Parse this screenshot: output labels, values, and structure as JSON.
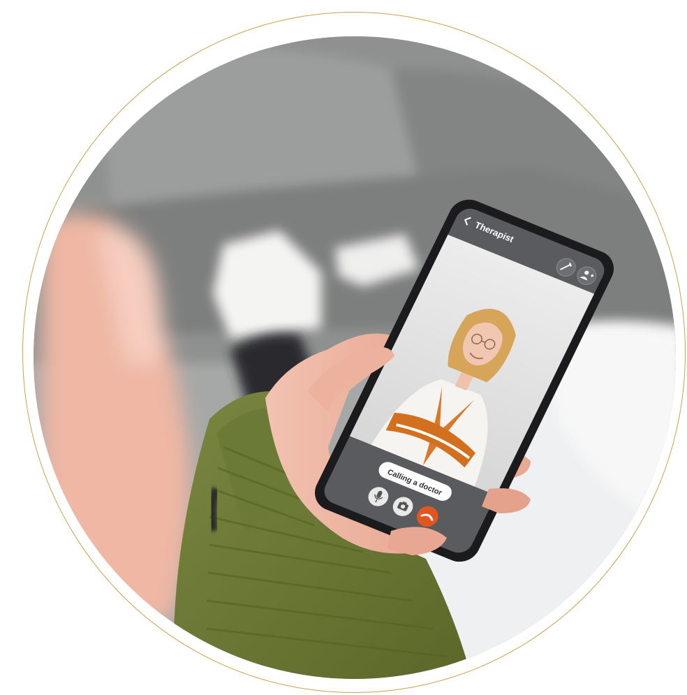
{
  "colors": {
    "ring": "#c9a24a",
    "sofa": "#8d8f8e",
    "sweater": "#6e7a33",
    "phone_frame": "#1b1b1d",
    "app_background": "#595b5e",
    "end_call": "#e2561f"
  },
  "phone": {
    "back_icon": "chevron-left-icon",
    "title": "Therapist",
    "edit_icon": "pencil-icon",
    "add_contact_icon": "person-add-icon",
    "status": "Calling a doctor",
    "mic_icon": "microphone-icon",
    "camera_icon": "camera-icon",
    "end_call_icon": "phone-hangup-icon"
  }
}
